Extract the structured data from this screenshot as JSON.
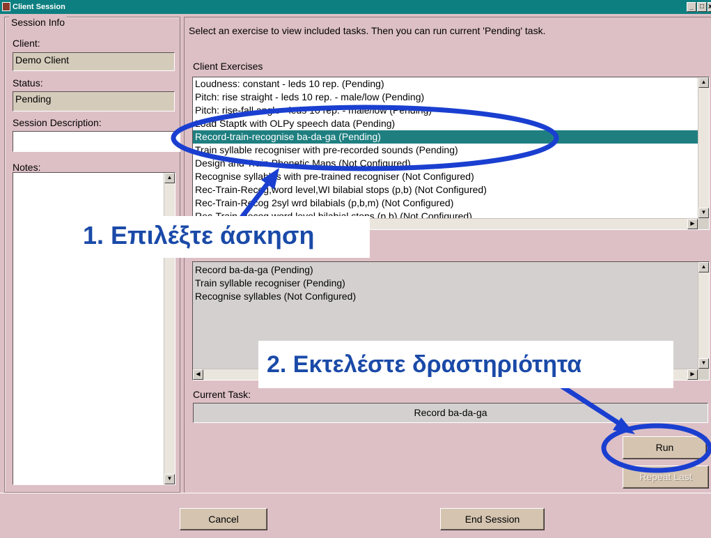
{
  "window": {
    "title": "Client Session",
    "minimize": "_",
    "maximize": "□",
    "close": "x"
  },
  "session_info": {
    "legend": "Session Info",
    "client_label": "Client:",
    "client_value": "Demo Client",
    "status_label": "Status:",
    "status_value": "Pending",
    "description_label": "Session Description:",
    "description_value": "",
    "notes_label": "Notes:",
    "notes_value": ""
  },
  "instruction": "Select an exercise to view included tasks. Then you can run current 'Pending' task.",
  "exercises": {
    "label": "Client Exercises",
    "items": [
      "Loudness: constant - leds 10 rep.  (Pending)",
      "Pitch: rise straight - leds 10 rep. - male/low  (Pending)",
      "Pitch: rise-fall angle - leds 10 rep. - male/low  (Pending)",
      "Load Staptk with OLPy speech data  (Pending)",
      "Record-train-recognise ba-da-ga  (Pending)",
      "Train syllable recogniser with pre-recorded sounds  (Pending)",
      "Design and Train Phonetic Maps  (Not Configured)",
      "Recognise syllables with pre-trained recogniser  (Not Configured)",
      "Rec-Train-Recog,word level,WI bilabial stops (p,b)  (Not Configured)",
      "Rec-Train-Recog 2syl wrd bilabials (p,b,m)  (Not Configured)",
      "Rec-Train-Recog word level bilabial stops (p,b)  (Not Configured)"
    ],
    "selected_index": 4
  },
  "tasks": {
    "items": [
      "Record ba-da-ga (Pending)",
      "Train syllable recogniser (Pending)",
      "Recognise syllables (Not Configured)"
    ]
  },
  "current_task": {
    "label": "Current Task:",
    "value": "Record ba-da-ga"
  },
  "buttons": {
    "run": "Run",
    "repeat_last": "Repeat Last",
    "cancel": "Cancel",
    "end_session": "End Session"
  },
  "annotations": {
    "step1": "1. Επιλέξτε άσκηση",
    "step2": "2. Εκτελέστε δραστηριότητα",
    "color": "#1a3fd0"
  },
  "colors": {
    "titlebar": "#0e7f80",
    "background": "#ddc0c6",
    "selection": "#1f7f80"
  }
}
